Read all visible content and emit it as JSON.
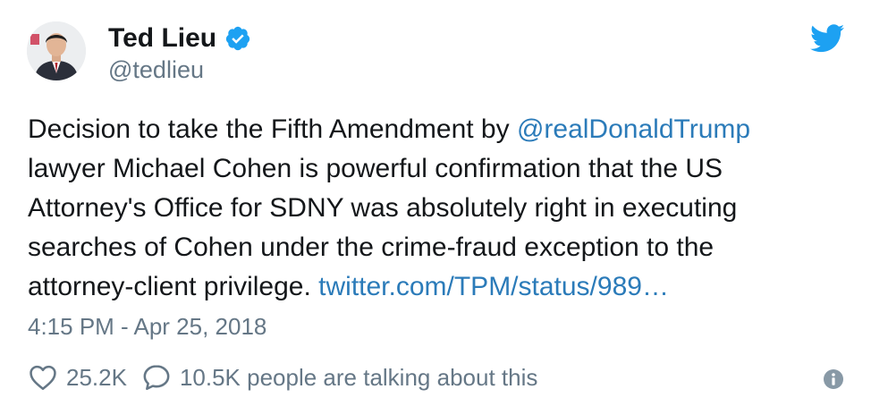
{
  "author": {
    "display_name": "Ted Lieu",
    "handle": "@tedlieu",
    "verified": true,
    "avatar_icon": "profile-photo"
  },
  "brand": {
    "icon": "twitter-bird-icon",
    "color": "#1da1f2"
  },
  "tweet": {
    "line1_text": "Decision to take the Fifth Amendment by ",
    "mention": "@realDonaldTrump",
    "line2": "lawyer Michael Cohen is powerful confirmation that the US",
    "line3": "Attorney's Office for SDNY was absolutely right in executing",
    "line4": "searches of Cohen under the crime-fraud exception to the",
    "line5_text": "attorney-client privilege. ",
    "link": "twitter.com/TPM/status/989…"
  },
  "timestamp": "4:15 PM - Apr 25, 2018",
  "actions": {
    "like_count": "25.2K",
    "talking_text": "10.5K people are talking about this"
  },
  "colors": {
    "text": "#14171a",
    "secondary": "#657786",
    "link": "#2b7bb9",
    "verified": "#1da1f2"
  }
}
